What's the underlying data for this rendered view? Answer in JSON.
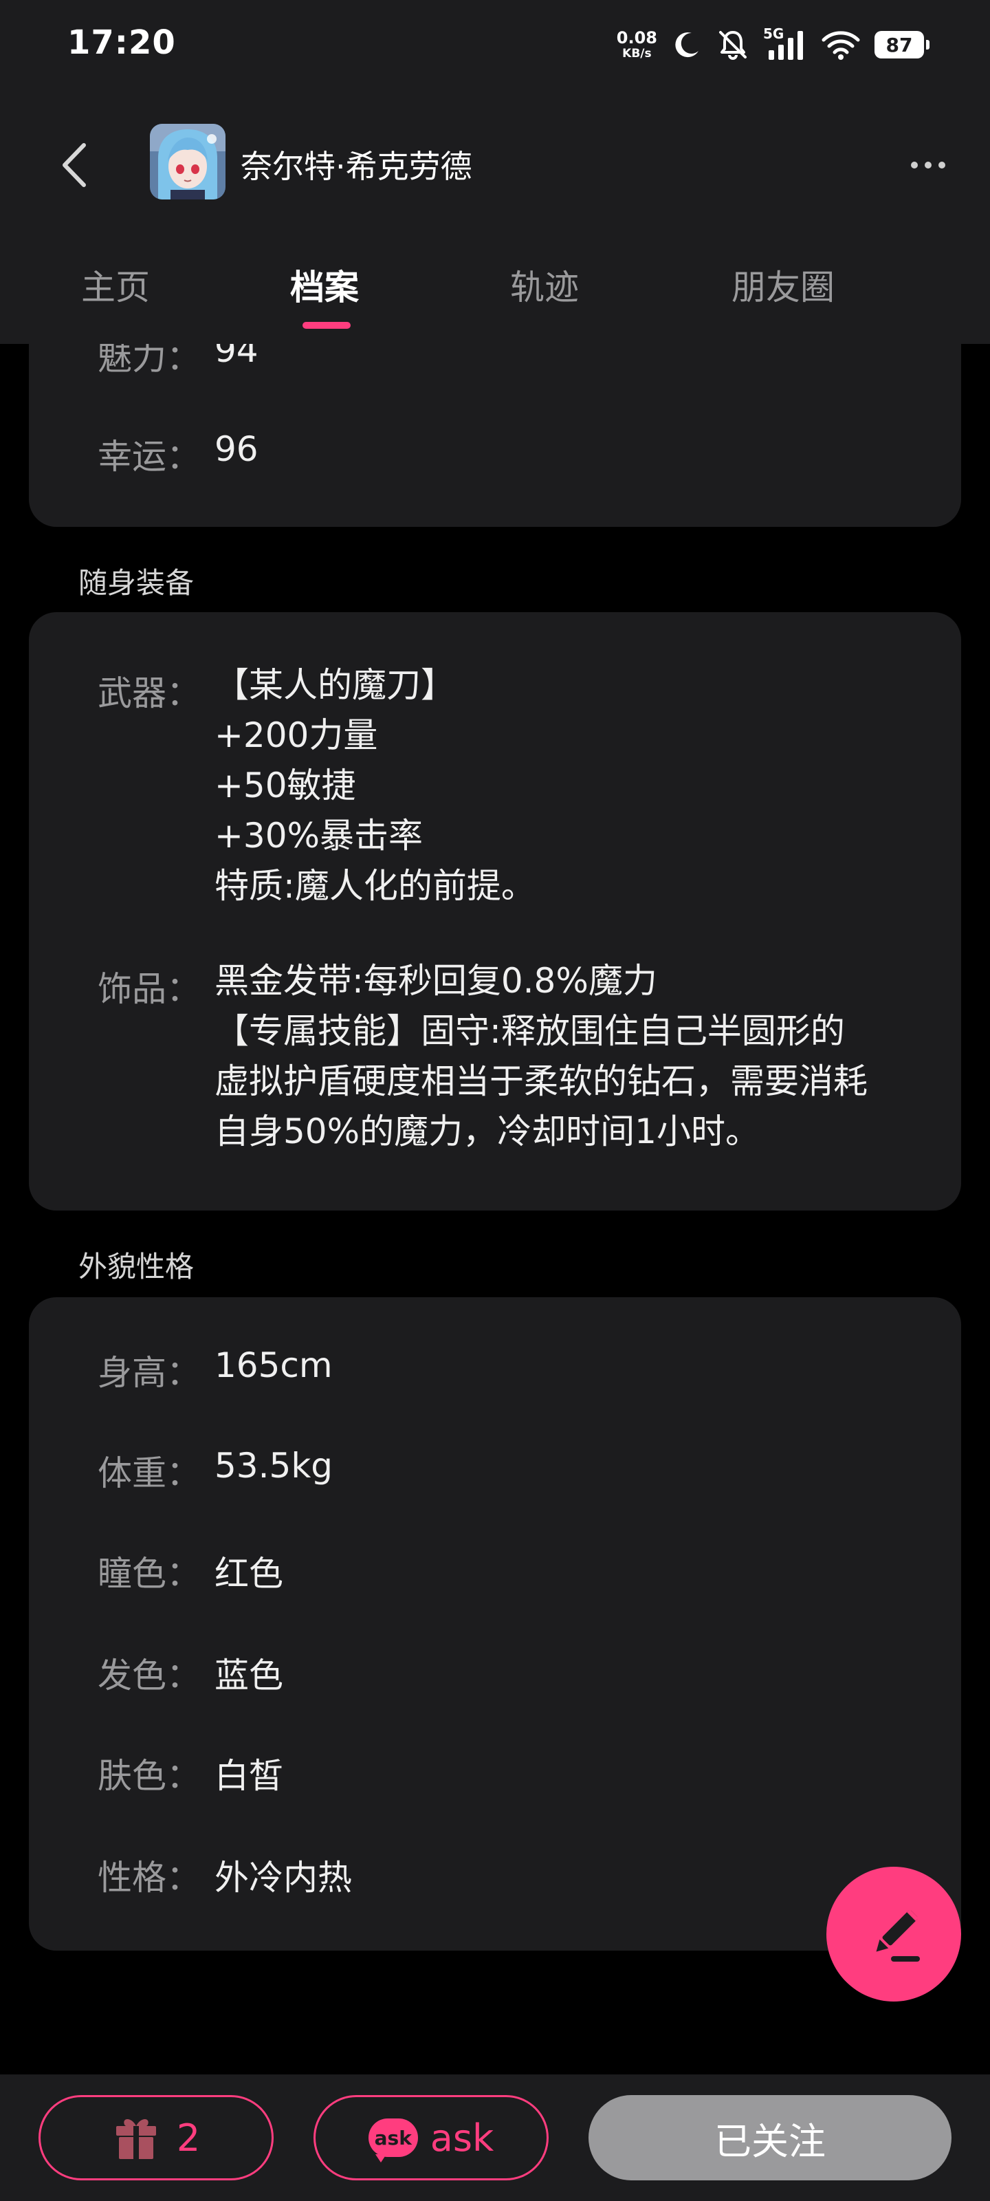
{
  "status_bar": {
    "time": "17:20",
    "net_speed_value": "0.08",
    "net_speed_unit": "KB/s",
    "network": "5G",
    "battery": "87",
    "icons": [
      "moon-icon",
      "bell-muted-icon",
      "signal-icon",
      "wifi-icon",
      "battery-icon"
    ]
  },
  "header": {
    "name": "奈尔特·希克劳德",
    "icons": [
      "back-arrow-icon",
      "avatar-image",
      "more-dots-icon"
    ]
  },
  "tabs": [
    {
      "label": "主页",
      "active": false
    },
    {
      "label": "档案",
      "active": true
    },
    {
      "label": "轨迹",
      "active": false
    },
    {
      "label": "朋友圈",
      "active": false
    }
  ],
  "stats": [
    {
      "label": "魅力：",
      "value": "94"
    },
    {
      "label": "幸运：",
      "value": "96"
    }
  ],
  "equipment": {
    "title": "随身装备",
    "weapon": {
      "label": "武器：",
      "lines": [
        "【某人的魔刀】",
        "+200力量",
        "+50敏捷",
        "+30%暴击率",
        "特质:魔人化的前提。"
      ]
    },
    "accessory": {
      "label": "饰品：",
      "lines": [
        "黑金发带:每秒回复0.8%魔力",
        "【专属技能】固守:释放围住自己半圆形的",
        "虚拟护盾硬度相当于柔软的钻石，需要消耗",
        "自身50%的魔力，冷却时间1小时。"
      ]
    }
  },
  "appearance": {
    "title": "外貌性格",
    "rows": [
      {
        "label": "身高：",
        "value": "165cm"
      },
      {
        "label": "体重：",
        "value": "53.5kg"
      },
      {
        "label": "瞳色：",
        "value": "红色"
      },
      {
        "label": "发色：",
        "value": "蓝色"
      },
      {
        "label": "肤色：",
        "value": "白皙"
      },
      {
        "label": "性格：",
        "value": "外冷内热"
      }
    ]
  },
  "fab": {
    "icon": "edit-pencil-icon"
  },
  "bottom_bar": {
    "gift_count": "2",
    "gift_icon": "gift-icon",
    "ask_badge": "ask",
    "ask_label": "ask",
    "follow_label": "已关注"
  },
  "colors": {
    "accent": "#ff3d7f",
    "card": "#1c1c1e",
    "background": "#000000",
    "muted_text": "#9a9a9c",
    "follow_button": "#9a9a9c"
  }
}
